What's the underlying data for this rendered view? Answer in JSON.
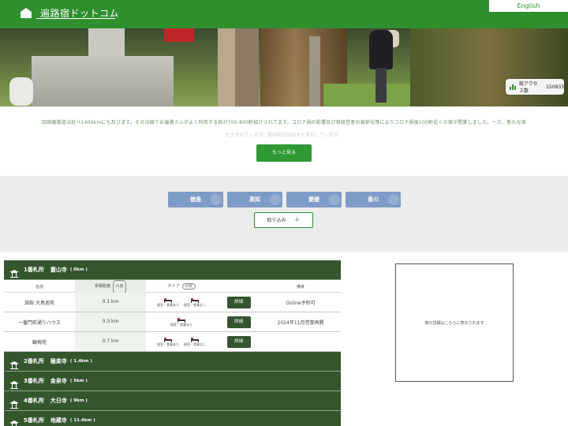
{
  "header": {
    "site_title": "遍路宿ドットコム",
    "lang_button": "English"
  },
  "hero": {
    "access_label": "総アクセス数",
    "access_count": "150833"
  },
  "intro": {
    "line1": "四国遍路道は延べ1400kmにも及びます。その沿線でお遍路さんがよく利用する宿が700-800軒紹介されてます。コロナ禍の影響及び宿経営者の高齢化等によりコロナ禍後100軒近くの宿が閉業しました。一方、新たな宿",
    "line2": "も生まれています。宿の状況は刻々と変化しています。",
    "more_button": "もっと見る"
  },
  "filter": {
    "prefectures": [
      "徳島",
      "高知",
      "愛媛",
      "香川"
    ],
    "narrow_button": "絞り込み",
    "narrow_plus": "＋"
  },
  "table_header": {
    "name": "名前",
    "distance": "累積距離",
    "distance_pill": "片側",
    "type": "タイプ",
    "type_pill": "片側",
    "note": "備考"
  },
  "temples": [
    {
      "num": "1番札所",
      "name": "霊山寺",
      "dist": "( 0km )"
    },
    {
      "num": "2番札所",
      "name": "極楽寺",
      "dist": "( 1.4km )"
    },
    {
      "num": "3番札所",
      "name": "金泉寺",
      "dist": "( 5km )"
    },
    {
      "num": "4番札所",
      "name": "大日寺",
      "dist": "( 9km )"
    },
    {
      "num": "5番札所",
      "name": "地蔵寺",
      "dist": "( 11.4km )"
    }
  ],
  "lodgings": [
    {
      "name": "旅館 大鳥居苑",
      "distance": "0.1 km",
      "types": [
        "個室・食事あり",
        "個室・食事なし"
      ],
      "detail": "詳細",
      "note": "Online予約可"
    },
    {
      "name": "一番門前通りハウス",
      "distance": "0.3 km",
      "types": [
        "個室・食事あり"
      ],
      "detail": "詳細",
      "note": "2024年11月営業再開"
    },
    {
      "name": "観梅苑",
      "distance": "0.7 km",
      "types": [
        "個室・食事あり",
        "個室・食事なし"
      ],
      "detail": "詳細",
      "note": ""
    }
  ],
  "map": {
    "placeholder": "宿の詳細はこちらに表示されます"
  },
  "colors": {
    "header_green": "#2f8f2f",
    "temple_bar": "#35552f",
    "pref_blue": "#7e9cc7"
  }
}
